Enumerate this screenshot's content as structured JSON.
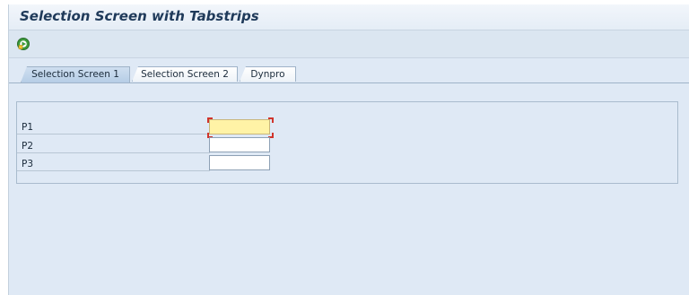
{
  "window": {
    "title": "Selection Screen with Tabstrips"
  },
  "toolbar": {
    "execute_icon": "execute-icon",
    "execute_color": "#3c9a3c"
  },
  "tabs": [
    {
      "label": "Selection Screen 1",
      "active": true
    },
    {
      "label": "Selection Screen 2",
      "active": false
    },
    {
      "label": "Dynpro",
      "active": false
    }
  ],
  "parameters": [
    {
      "label": "P1",
      "value": "",
      "focused": true
    },
    {
      "label": "P2",
      "value": "",
      "focused": false
    },
    {
      "label": "P3",
      "value": "",
      "focused": false
    }
  ],
  "colors": {
    "focus_field": "#fff3a6",
    "focus_marker": "#d0342c",
    "background": "#dfe9f5"
  }
}
